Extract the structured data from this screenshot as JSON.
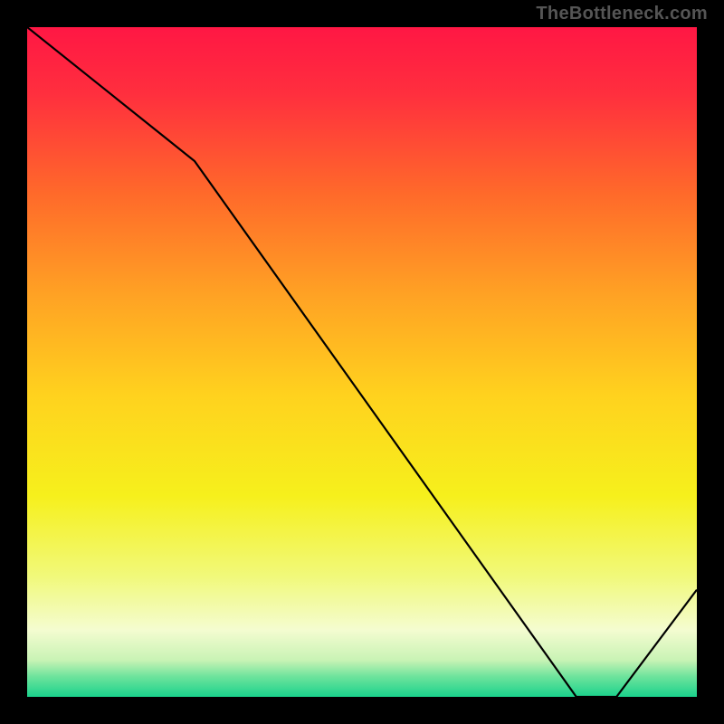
{
  "watermark": "TheBottleneck.com",
  "marker_label": "",
  "colors": {
    "watermark": "#555555",
    "line": "#000000",
    "marker": "#b22a2a"
  },
  "chart_data": {
    "type": "line",
    "title": "",
    "xlabel": "",
    "ylabel": "",
    "xlim": [
      0,
      100
    ],
    "ylim": [
      0,
      100
    ],
    "grid": false,
    "legend": false,
    "x": [
      0,
      25,
      82,
      88,
      100
    ],
    "values": [
      100,
      80,
      0,
      0,
      16
    ],
    "annotation": {
      "x_range": [
        76,
        88
      ],
      "y": 0,
      "text": ""
    },
    "background_gradient_stops": [
      {
        "pos": 0.0,
        "color": "#ff1744"
      },
      {
        "pos": 0.1,
        "color": "#ff2f3e"
      },
      {
        "pos": 0.25,
        "color": "#ff6a2a"
      },
      {
        "pos": 0.4,
        "color": "#ffa224"
      },
      {
        "pos": 0.55,
        "color": "#ffd21e"
      },
      {
        "pos": 0.7,
        "color": "#f6f01c"
      },
      {
        "pos": 0.82,
        "color": "#f1f97a"
      },
      {
        "pos": 0.9,
        "color": "#f4fcd0"
      },
      {
        "pos": 0.945,
        "color": "#c9f3b5"
      },
      {
        "pos": 0.97,
        "color": "#6de39c"
      },
      {
        "pos": 1.0,
        "color": "#1ad28c"
      }
    ]
  }
}
